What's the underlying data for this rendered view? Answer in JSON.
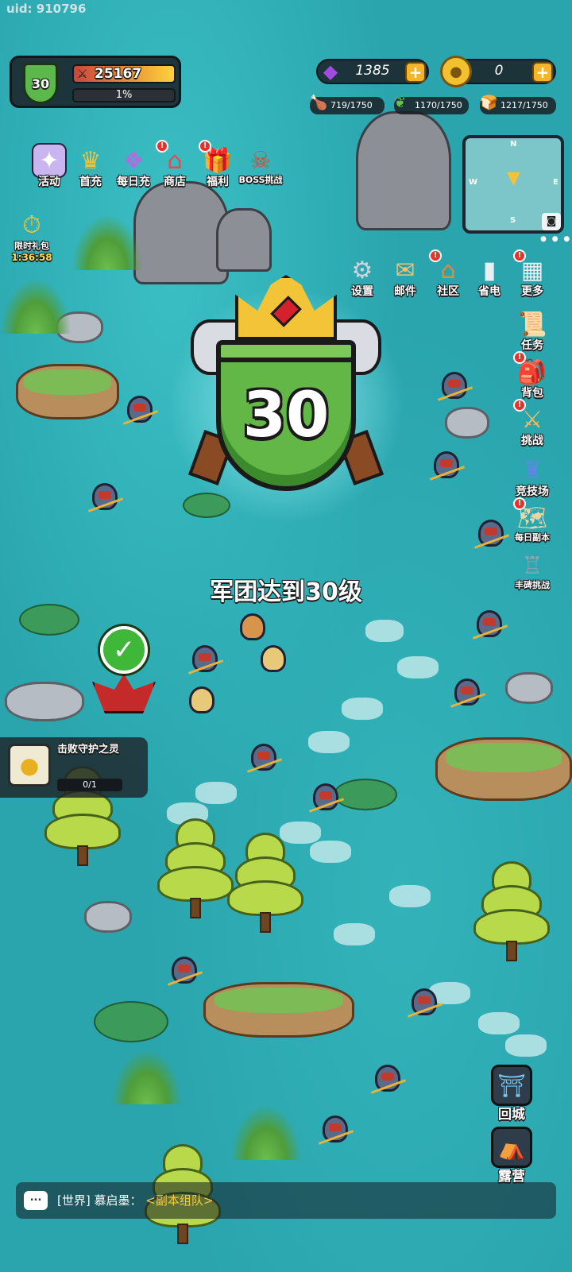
{
  "uid": "uid: 910796",
  "player": {
    "level": "30",
    "power": "25167",
    "exp_percent": "1%"
  },
  "currencies": {
    "gems": "1385",
    "gold": "0",
    "plus": "+"
  },
  "resources": {
    "meat": "719/1750",
    "herb": "1170/1750",
    "bread": "1217/1750"
  },
  "top_menu": [
    {
      "label": "活动",
      "icon": "event-icon"
    },
    {
      "label": "首充",
      "icon": "first-charge-icon"
    },
    {
      "label": "每日充",
      "icon": "daily-charge-icon"
    },
    {
      "label": "商店",
      "icon": "shop-icon",
      "badge": true
    },
    {
      "label": "福利",
      "icon": "welfare-icon",
      "badge": true
    },
    {
      "label": "BOSS挑战",
      "icon": "boss-icon"
    }
  ],
  "timer_gift": {
    "label": "限时礼包",
    "time": "1:36:58"
  },
  "minimap": {
    "n": "N",
    "s": "S",
    "e": "E",
    "w": "W"
  },
  "settings_row": [
    {
      "label": "设置",
      "icon": "gear-icon"
    },
    {
      "label": "邮件",
      "icon": "mail-icon"
    },
    {
      "label": "社区",
      "icon": "community-icon",
      "badge": true
    },
    {
      "label": "省电",
      "icon": "battery-icon"
    },
    {
      "label": "更多",
      "icon": "more-icon",
      "badge": true
    }
  ],
  "side_menu": [
    {
      "label": "任务",
      "icon": "quest-scroll-icon"
    },
    {
      "label": "背包",
      "icon": "backpack-icon",
      "badge": true
    },
    {
      "label": "挑战",
      "icon": "challenge-icon",
      "badge": true
    },
    {
      "label": "竞技场",
      "icon": "arena-icon"
    },
    {
      "label": "每日副本",
      "icon": "daily-dungeon-icon",
      "badge": true
    },
    {
      "label": "丰碑挑战",
      "icon": "monument-icon"
    }
  ],
  "level_up": {
    "number": "30",
    "message": "军团达到30级"
  },
  "quest": {
    "title": "击败守护之灵",
    "progress": "0/1"
  },
  "bottom_right": [
    {
      "label": "回城",
      "icon": "return-city-icon"
    },
    {
      "label": "露营",
      "icon": "camp-icon"
    }
  ],
  "chat": {
    "channel": "[世界]",
    "sender": "慕启墨：",
    "message": "<副本组队>",
    "bubble": "..."
  },
  "colors": {
    "water": "#2aa5ae",
    "shield_green": "#63b746",
    "crown_gold": "#f3c437",
    "badge_red": "#e5322b"
  }
}
